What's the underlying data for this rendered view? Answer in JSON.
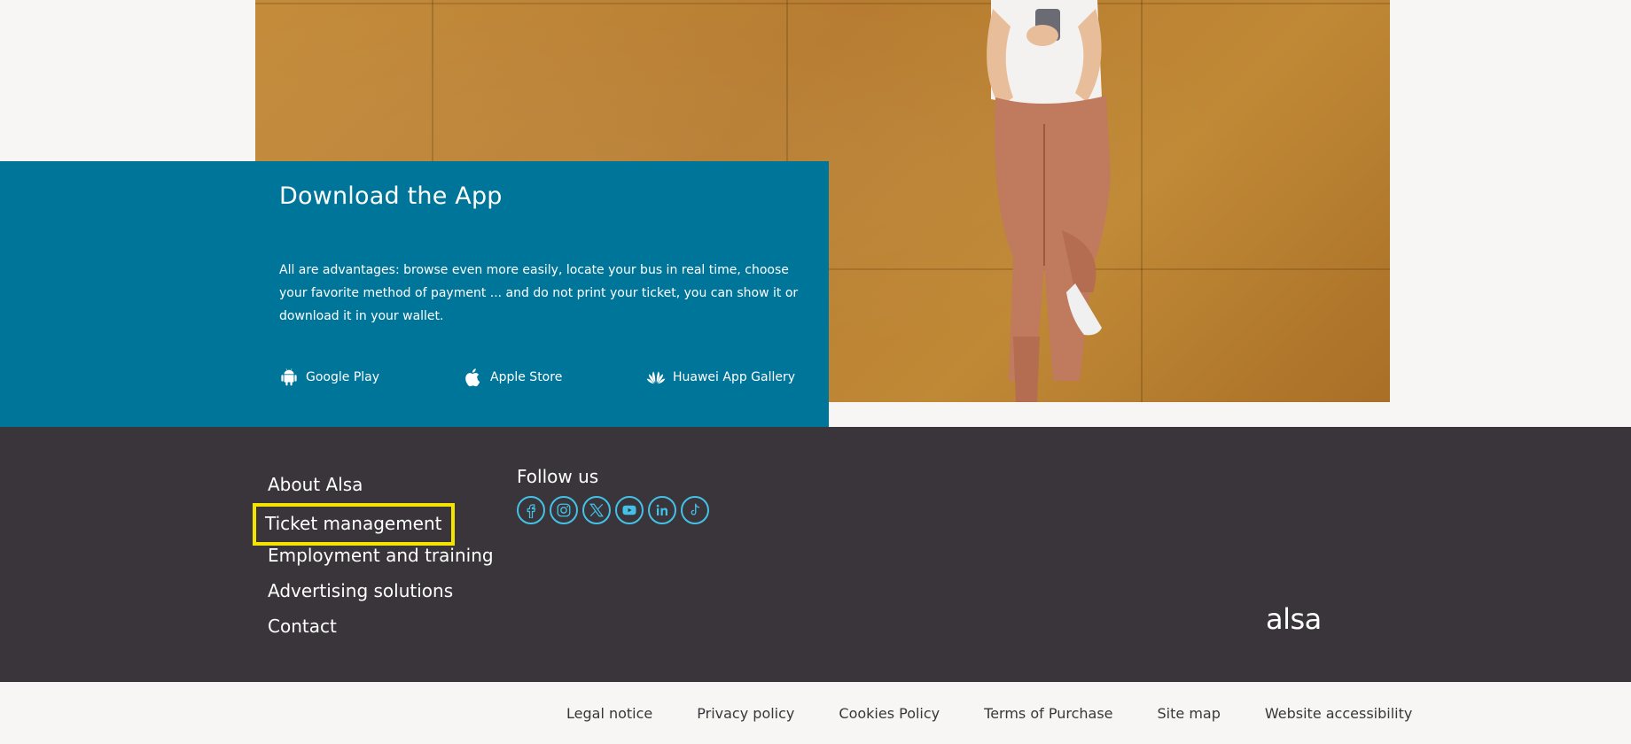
{
  "app": {
    "title": "Download the App",
    "description": "All are advantages: browse even more easily, locate your bus in real time, choose your favorite method of payment ... and do not print your ticket, you can show it or download it in your wallet.",
    "stores": [
      {
        "label": "Google Play",
        "icon": "android-icon"
      },
      {
        "label": "Apple Store",
        "icon": "apple-icon"
      },
      {
        "label": "Huawei App Gallery",
        "icon": "huawei-icon"
      }
    ]
  },
  "footer": {
    "links": [
      "About Alsa",
      "Ticket management",
      "Employment and training",
      "Advertising solutions",
      "Contact"
    ],
    "follow_title": "Follow us",
    "social": [
      "facebook-icon",
      "instagram-icon",
      "x-icon",
      "youtube-icon",
      "linkedin-icon",
      "tiktok-icon"
    ],
    "logo": "alsa",
    "accent_color": "#43c2e8",
    "highlight_color": "#f5e400"
  },
  "legal": [
    "Legal notice",
    "Privacy policy",
    "Cookies Policy",
    "Terms of Purchase",
    "Site map",
    "Website accessibility"
  ],
  "colors": {
    "panel": "#00759a",
    "footer": "#3a353a",
    "page": "#f7f6f4"
  }
}
